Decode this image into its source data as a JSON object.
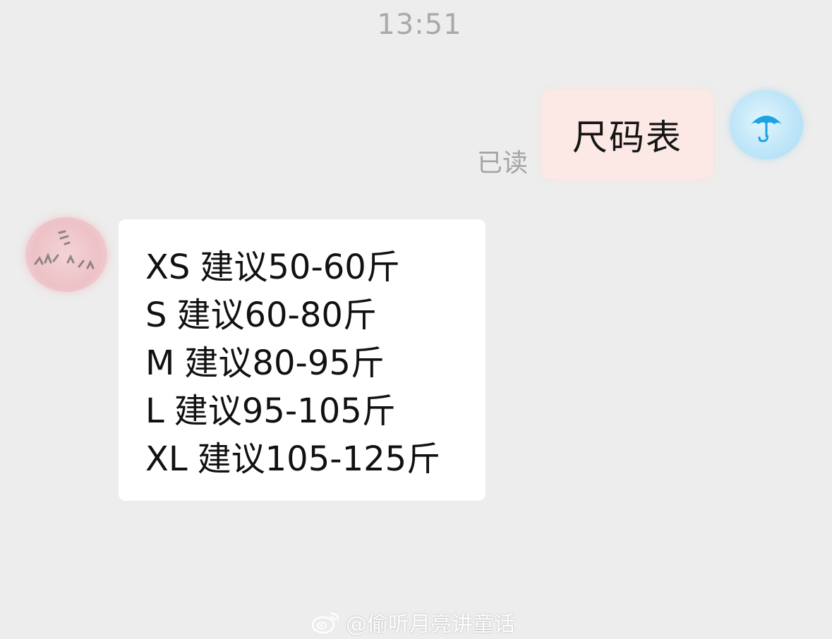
{
  "chat": {
    "timestamp": "13:51",
    "outgoing": {
      "text": "尺码表",
      "read_status": "已读",
      "avatar_icon": "umbrella-icon"
    },
    "incoming": {
      "avatar_icon": "avatar-image",
      "rows": [
        {
          "size": "XS",
          "text": "建议50-60斤"
        },
        {
          "size": "S",
          "text": "建议60-80斤"
        },
        {
          "size": "M",
          "text": "建议80-95斤"
        },
        {
          "size": "L",
          "text": "建议95-105斤"
        },
        {
          "size": "XL",
          "text": "建议105-125斤"
        }
      ]
    }
  },
  "watermark": {
    "text": "@偷听月亮讲童话",
    "icon": "weibo-logo-icon"
  },
  "colors": {
    "background": "#ededed",
    "outgoing_bubble": "#fce9e6",
    "incoming_bubble": "#ffffff",
    "umbrella": "#1ba3e3"
  }
}
